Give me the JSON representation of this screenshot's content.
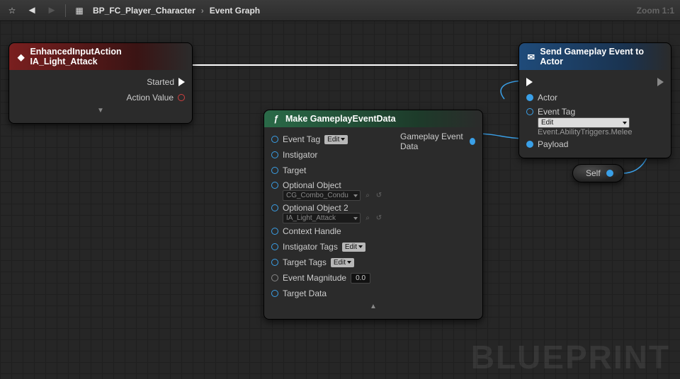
{
  "toolbar": {
    "breadcrumb_root": "BP_FC_Player_Character",
    "breadcrumb_leaf": "Event Graph",
    "zoom": "Zoom 1:1"
  },
  "watermark": "BLUEPRINT",
  "node_input": {
    "title": "EnhancedInputAction IA_Light_Attack",
    "pins": {
      "started": "Started",
      "action_value": "Action Value"
    }
  },
  "node_make": {
    "title": "Make GameplayEventData",
    "out_label": "Gameplay Event Data",
    "pins": {
      "event_tag": "Event Tag",
      "instigator": "Instigator",
      "target": "Target",
      "optional_object": "Optional Object",
      "optional_object2": "Optional Object 2",
      "context_handle": "Context Handle",
      "instigator_tags": "Instigator Tags",
      "target_tags": "Target Tags",
      "event_magnitude": "Event Magnitude",
      "target_data": "Target Data"
    },
    "edit_label": "Edit",
    "asset1": "CG_Combo_Condu",
    "asset2": "IA_Light_Attack",
    "magnitude_value": "0.0"
  },
  "node_send": {
    "title": "Send Gameplay Event to Actor",
    "pins": {
      "actor": "Actor",
      "event_tag_label": "Event Tag",
      "payload": "Payload"
    },
    "event_tag_value": "Edit",
    "event_tag_path": "Event.AbilityTriggers.Melee"
  },
  "node_self": {
    "label": "Self"
  },
  "icons": {
    "star": "☆",
    "back": "◀",
    "fwd": "▶",
    "grid": "▦",
    "graph": "⎇",
    "event": "◆",
    "fx": "ƒ",
    "mail": "✉",
    "search": "⌕",
    "reset": "↺"
  }
}
